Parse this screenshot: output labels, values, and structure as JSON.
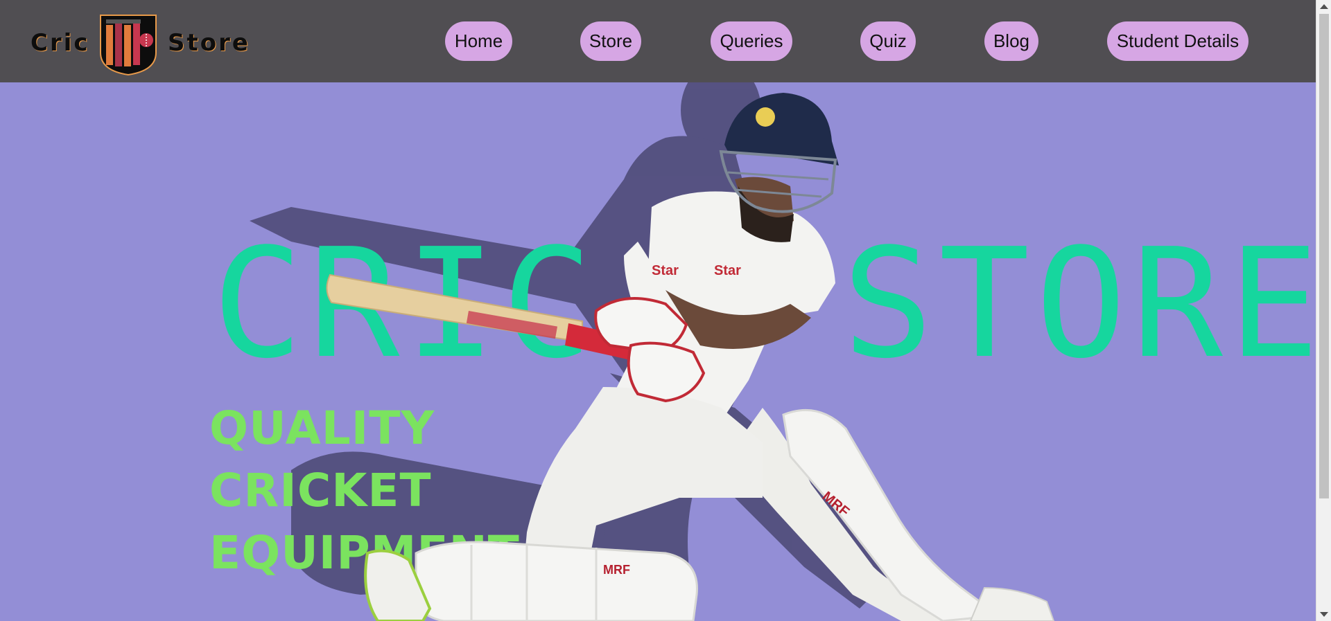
{
  "brand": {
    "name_left": "Cric",
    "name_right": "Store",
    "logo_icon": "cricket-crest-logo"
  },
  "nav": {
    "items": [
      {
        "label": "Home"
      },
      {
        "label": "Store"
      },
      {
        "label": "Queries"
      },
      {
        "label": "Quiz"
      },
      {
        "label": "Blog"
      },
      {
        "label": "Student Details"
      }
    ]
  },
  "hero": {
    "title_left": "CRIC",
    "title_right": "STORE",
    "subtitle_line1": "QUALITY CRICKET",
    "subtitle_line2": "EQUIPMENT",
    "image": "cricket-batsman-photo"
  },
  "colors": {
    "navbar_bg": "#504e52",
    "nav_button_bg": "#d6a6e4",
    "hero_bg": "#938ed6",
    "title_color": "#16d69e",
    "subtitle_color": "#7be35f"
  }
}
